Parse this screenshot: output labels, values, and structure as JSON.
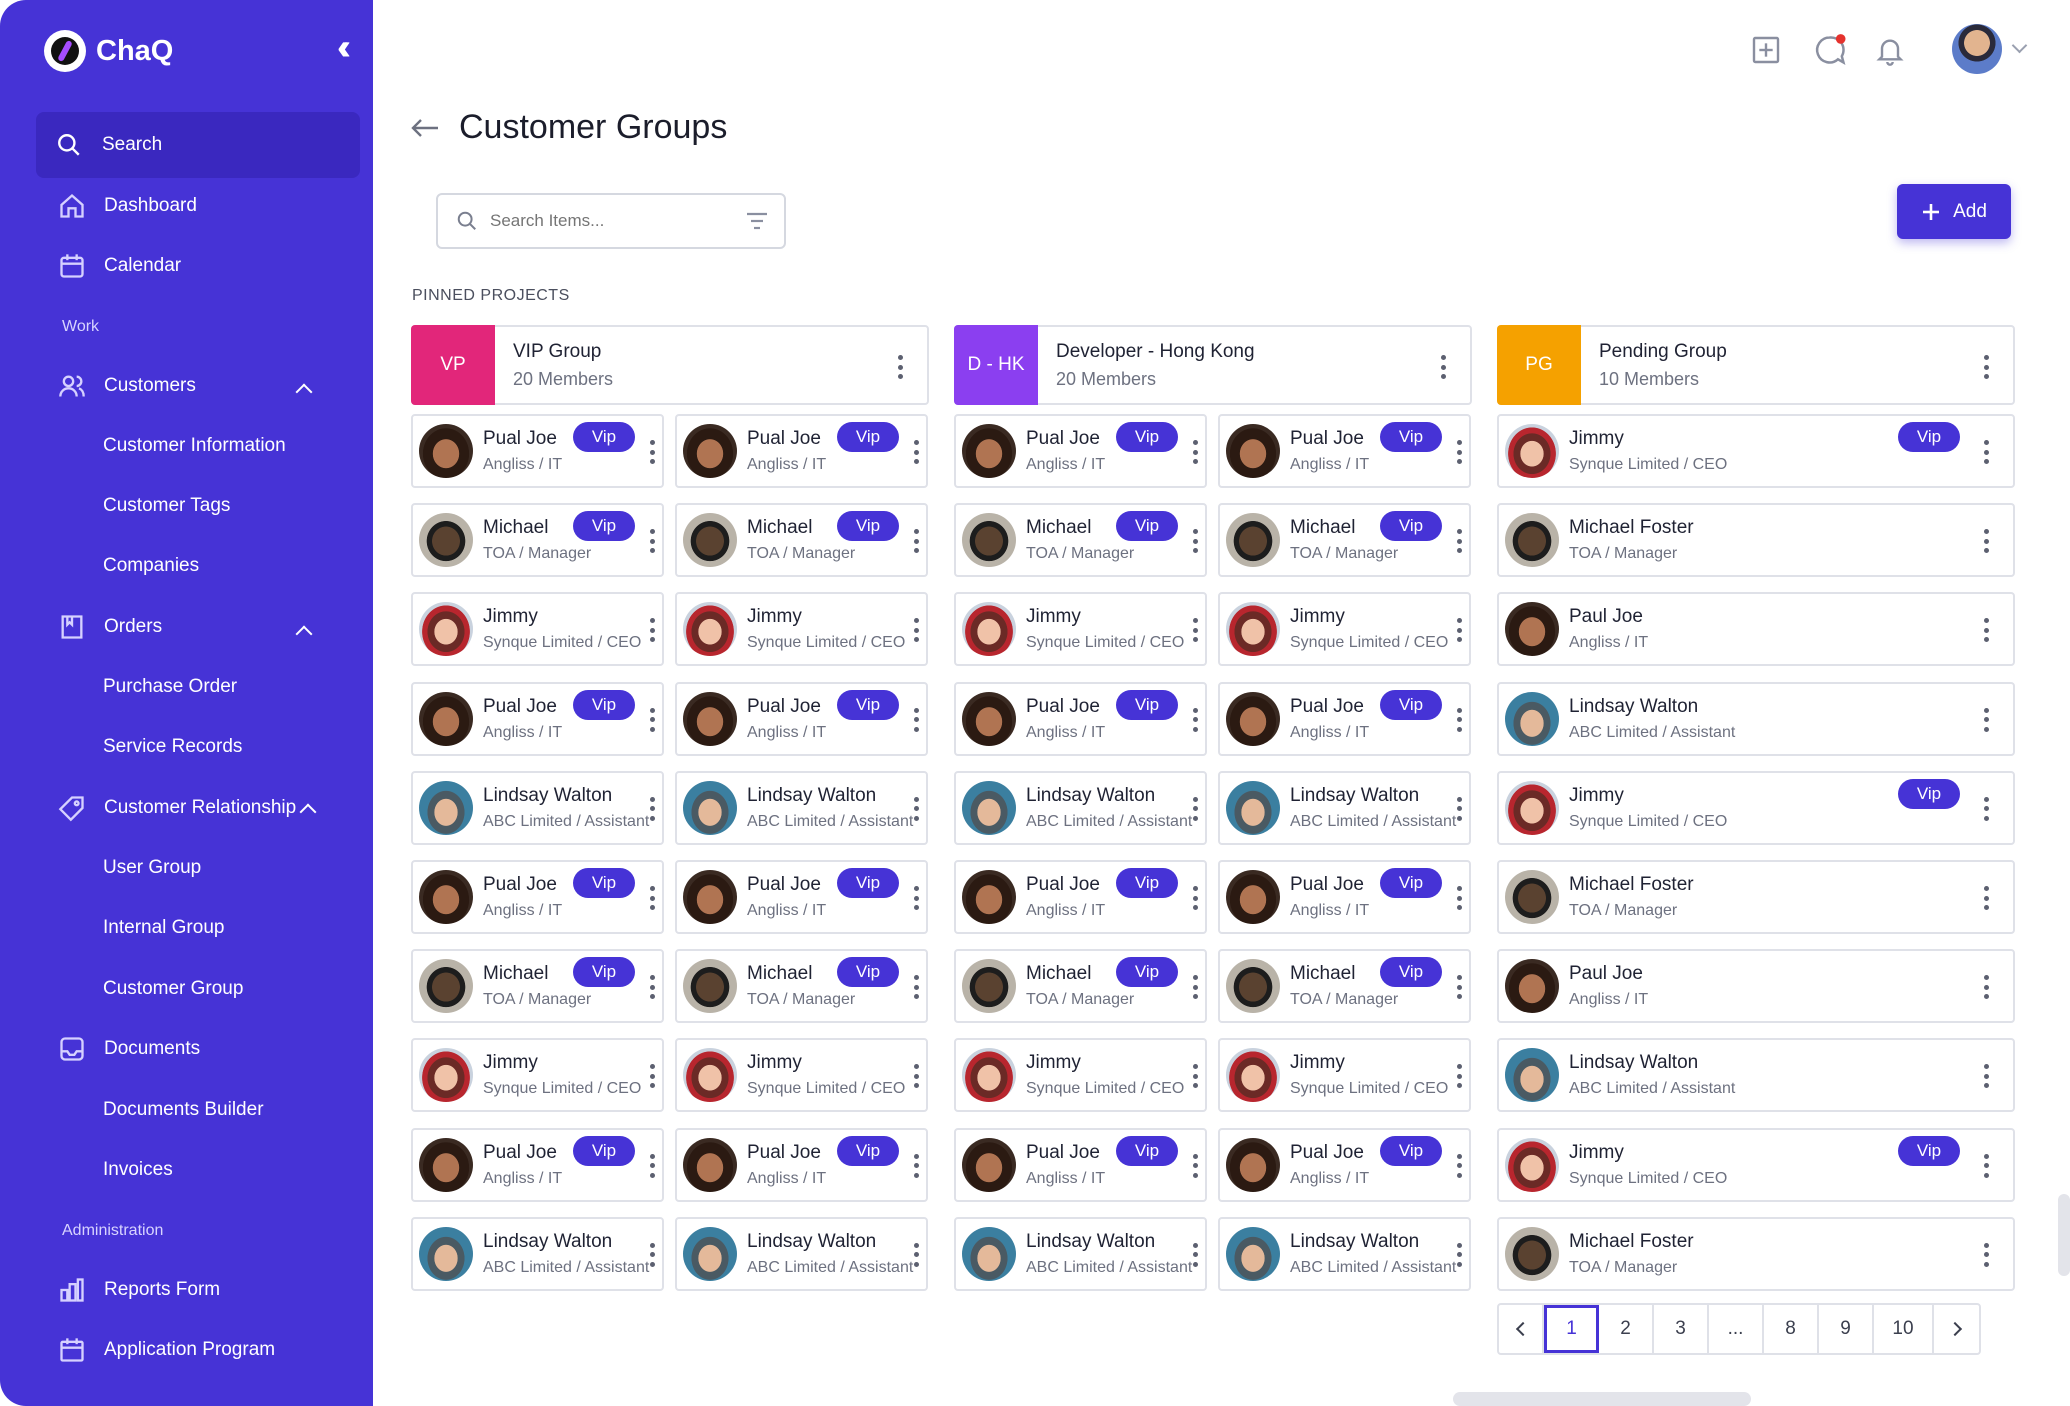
{
  "app": {
    "name": "ChaQ"
  },
  "sidebar": {
    "search_label": "Search",
    "dashboard": "Dashboard",
    "calendar": "Calendar",
    "section_work": "Work",
    "customers": "Customers",
    "customer_information": "Customer Information",
    "customer_tags": "Customer Tags",
    "companies": "Companies",
    "orders": "Orders",
    "purchase_order": "Purchase Order",
    "service_records": "Service Records",
    "customer_relationship": "Customer Relationship",
    "user_group": "User Group",
    "internal_group": "Internal Group",
    "customer_group": "Customer Group",
    "documents": "Documents",
    "documents_builder": "Documents Builder",
    "invoices": "Invoices",
    "section_admin": "Administration",
    "reports_form": "Reports Form",
    "application_program": "Application Program"
  },
  "page": {
    "title": "Customer Groups",
    "search_placeholder": "Search Items...",
    "add_label": "Add",
    "pinned_label": "PINNED PROJECTS"
  },
  "groups": [
    {
      "badge": "VP",
      "name": "VIP Group",
      "count": "20 Members",
      "color": "#e2267a"
    },
    {
      "badge": "D - HK",
      "name": "Developer - Hong Kong",
      "count": "20 Members",
      "color": "#8b3ff0"
    },
    {
      "badge": "PG",
      "name": "Pending Group",
      "count": "10 Members",
      "color": "#f5a100"
    }
  ],
  "people": {
    "pual": {
      "name": "Pual Joe",
      "role": "Angliss / IT"
    },
    "michael": {
      "name": "Michael",
      "role": "TOA  / Manager"
    },
    "jimmy": {
      "name": "Jimmy",
      "role": "Synque Limited / CEO"
    },
    "lindsay": {
      "name": "Lindsay Walton",
      "role": "ABC Limited / Assistant"
    },
    "michael_foster": {
      "name": "Michael Foster",
      "role": "TOA  / Manager"
    },
    "paul": {
      "name": "Paul Joe",
      "role": "Angliss / IT"
    }
  },
  "vip_label": "Vip",
  "pending_rows": [
    {
      "name": "Jimmy",
      "role": "Synque Limited / CEO",
      "vip": true
    },
    {
      "name": "Michael Foster",
      "role": "TOA  / Manager",
      "vip": false
    },
    {
      "name": "Paul Joe",
      "role": "Angliss / IT",
      "vip": false
    },
    {
      "name": "Lindsay Walton",
      "role": "ABC Limited / Assistant",
      "vip": false
    },
    {
      "name": "Jimmy",
      "role": "Synque Limited / CEO",
      "vip": true
    },
    {
      "name": "Michael Foster",
      "role": "TOA  / Manager",
      "vip": false
    },
    {
      "name": "Paul Joe",
      "role": "Angliss / IT",
      "vip": false
    },
    {
      "name": "Lindsay Walton",
      "role": "ABC Limited / Assistant",
      "vip": false
    },
    {
      "name": "Jimmy",
      "role": "Synque Limited / CEO",
      "vip": true
    },
    {
      "name": "Michael Foster",
      "role": "TOA  / Manager",
      "vip": false
    }
  ],
  "pagination": {
    "pages": [
      "1",
      "2",
      "3",
      "...",
      "8",
      "9",
      "10"
    ],
    "current": "1"
  },
  "colors": {
    "accent": "#4633d6",
    "notification_dot": "#e5322d"
  }
}
